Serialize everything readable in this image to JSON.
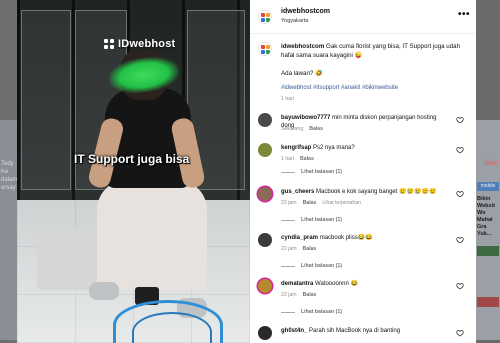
{
  "backdrop": {
    "left_text": "Tedy Ke dalam ersay",
    "right_logo": "idwe",
    "right_badge": "mobile",
    "right_text": "Bikin Websit Wo Mahal Gra Yuk...",
    "right_tag1": "",
    "right_tag2": ""
  },
  "media": {
    "watermark": "IDwebhost",
    "caption": "IT Support juga bisa"
  },
  "header": {
    "account": "idwebhostcom",
    "location": "Yogyakarta",
    "more_icon": "more-horizontal-icon"
  },
  "post": {
    "username": "idwebhostcom",
    "text": " Gak cuma florist yang bisa, IT Support juga udah hafal sama suara kayagini 😜",
    "question": "Ada lawan? 🤣",
    "hashtags": "#idwebhost #itsupport #anakit #bikinwebsite",
    "time": "1 hari"
  },
  "comments": [
    {
      "username": "bayuwibowo7777",
      "text": " min minta diskon perpanjangan hosting dong",
      "time": "Sekarang",
      "reply": "Balas",
      "translate": "",
      "replies": "",
      "ring": false,
      "avatar_color": "#4a4a4a"
    },
    {
      "username": "kengrifsap",
      "text": " Ps2 nya mana?",
      "time": "1 hari",
      "reply": "Balas",
      "translate": "",
      "replies": "Lihat balasan (1)",
      "ring": false,
      "avatar_color": "#7a8a3a"
    },
    {
      "username": "gus_cheers",
      "text": " Macbook e kok sayang banget 😢😢😢😢😢",
      "time": "23 jam",
      "reply": "Balas",
      "translate": "Lihat terjemahan",
      "replies": "Lihat balasan (1)",
      "ring": true,
      "avatar_color": "#8c6a55"
    },
    {
      "username": "cyndia_pram",
      "text": " macbook pliss😂😂",
      "time": "22 jam",
      "reply": "Balas",
      "translate": "",
      "replies": "Lihat balasan (1)",
      "ring": false,
      "avatar_color": "#3b3b3b"
    },
    {
      "username": "dematantra",
      "text": " Watoooonnn 😂",
      "time": "22 jam",
      "reply": "Balas",
      "translate": "",
      "replies": "Lihat balasan (1)",
      "ring": true,
      "avatar_color": "#b58a2e"
    },
    {
      "username": "gh0st4n_",
      "text": " Parah sih MacBook nya di banting",
      "time": "",
      "reply": "",
      "translate": "",
      "replies": "",
      "ring": false,
      "avatar_color": "#2a2a2a"
    }
  ],
  "colors": {
    "hashtag": "#3a5a96",
    "story_ring": "#d6249f",
    "muted": "#8e8e8e"
  }
}
